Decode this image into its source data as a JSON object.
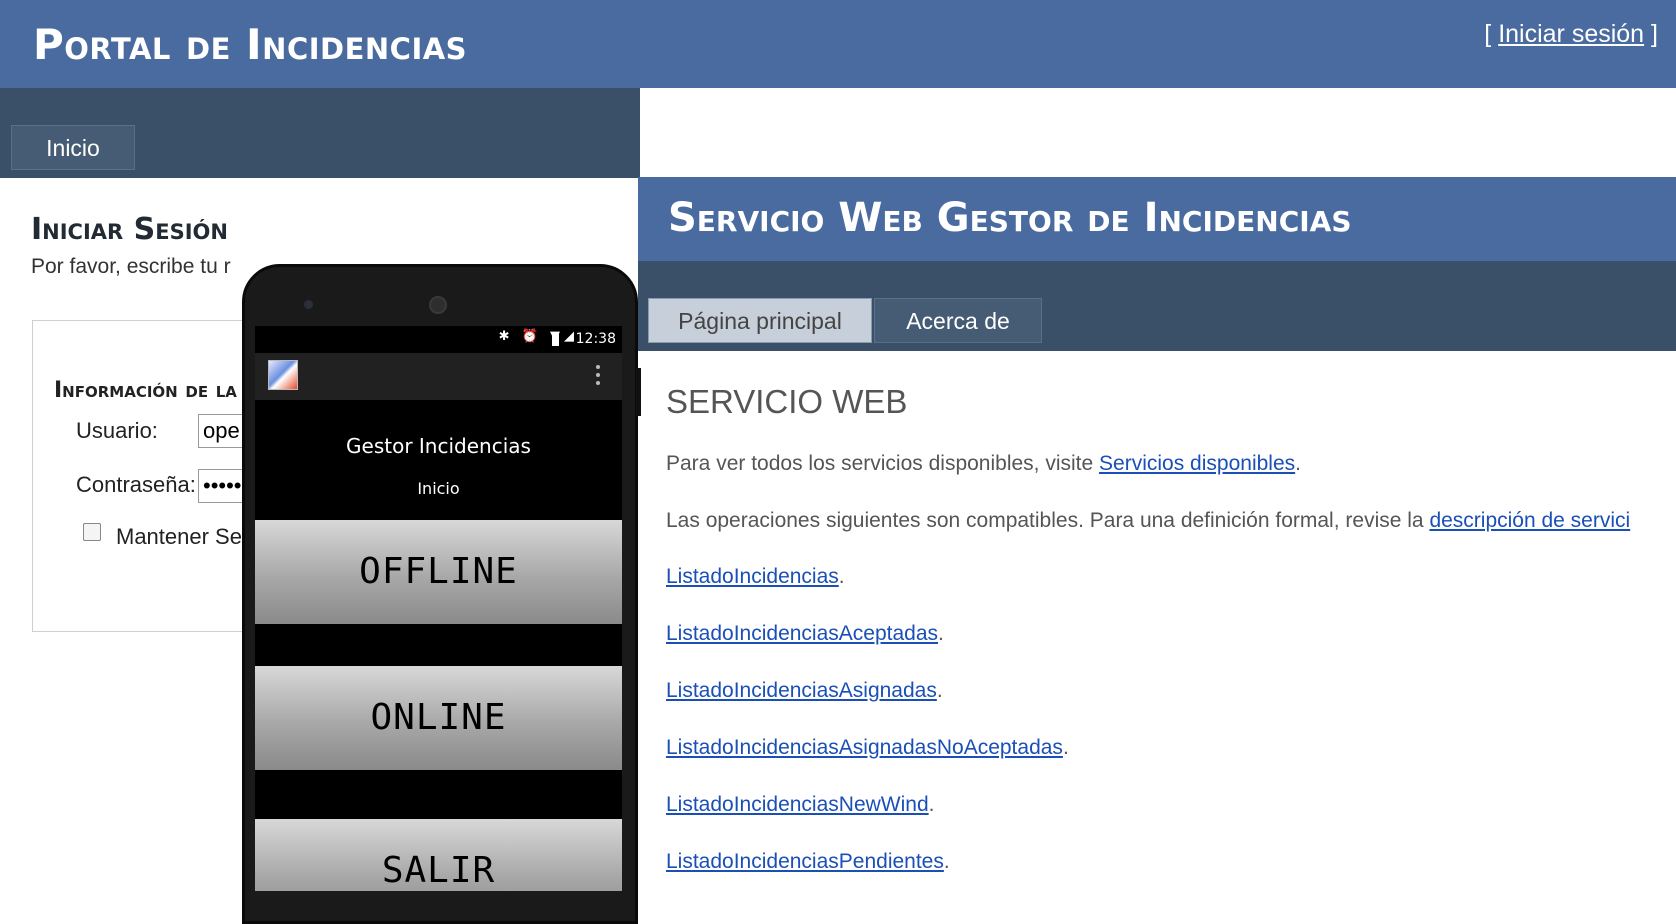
{
  "portal": {
    "title": "Portal de Incidencias",
    "login_open": "[ ",
    "login_link": "Iniciar sesión",
    "login_close": " ]",
    "nav": {
      "home": "Inicio"
    },
    "login": {
      "heading": "Iniciar Sesión",
      "instructions": "Por favor, escribe tu r",
      "fieldset_legend": "Información de la",
      "username_label": "Usuario:",
      "username_value": "ope",
      "password_label": "Contraseña:",
      "password_value": "•••••",
      "remember_label": "Mantener Se"
    }
  },
  "webservice": {
    "title": "Servicio Web Gestor de Incidencias",
    "tabs": [
      "Página principal",
      "Acerca de"
    ],
    "content_title": "SERVICIO WEB",
    "para1_text": "Para ver todos los servicios disponibles, visite ",
    "para1_link": "Servicios disponibles",
    "para1_end": ".",
    "para2_text": "Las operaciones siguientes son compatibles. Para una definición formal, revise la ",
    "para2_link": "descripción de servici",
    "operations": [
      "ListadoIncidencias",
      "ListadoIncidenciasAceptadas",
      "ListadoIncidenciasAsignadas",
      "ListadoIncidenciasAsignadasNoAceptadas",
      "ListadoIncidenciasNewWind",
      "ListadoIncidenciasPendientes"
    ],
    "op_suffix": "."
  },
  "phone": {
    "status_icons": "✱ ⏰ ▼◢",
    "time": "12:38",
    "app_icon": "app-logo-icon",
    "app_title": "Gestor Incidencias",
    "app_subtitle": "Inicio",
    "buttons": {
      "offline": "OFFLINE",
      "online": "ONLINE",
      "salir": "SALIR"
    }
  },
  "colors": {
    "header_blue": "#4a6b9f",
    "nav_dark": "#3a5068",
    "link_blue": "#1a4fb8"
  }
}
